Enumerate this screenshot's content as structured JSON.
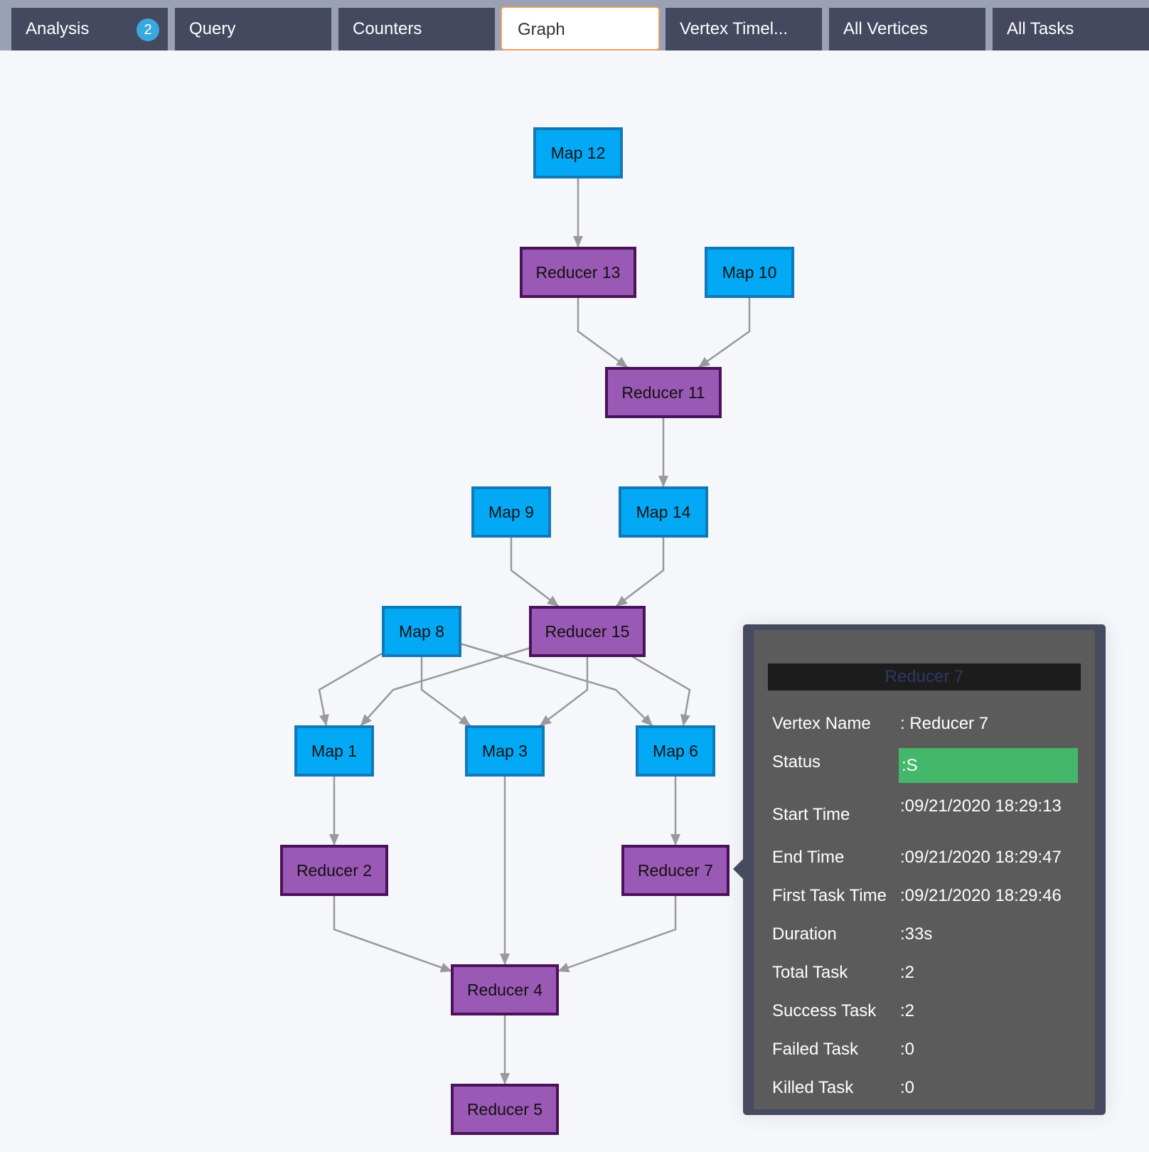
{
  "tabs": [
    {
      "label": "Analysis",
      "badge": "2",
      "active": false
    },
    {
      "label": "Query",
      "active": false
    },
    {
      "label": "Counters",
      "active": false
    },
    {
      "label": "Graph",
      "active": true
    },
    {
      "label": "Vertex Timel...",
      "active": false
    },
    {
      "label": "All Vertices",
      "active": false
    },
    {
      "label": "All Tasks",
      "active": false
    }
  ],
  "colors": {
    "map_fill": "#03a9f4",
    "map_stroke": "#1378b7",
    "reducer_fill": "#9b59b6",
    "reducer_stroke": "#4a1259",
    "status_success": "#44b76b",
    "active_tab_border": "#f0a060"
  },
  "graph": {
    "nodes": [
      {
        "id": "map12",
        "label": "Map 12",
        "type": "map"
      },
      {
        "id": "red13",
        "label": "Reducer 13",
        "type": "reducer"
      },
      {
        "id": "map10",
        "label": "Map 10",
        "type": "map"
      },
      {
        "id": "red11",
        "label": "Reducer 11",
        "type": "reducer"
      },
      {
        "id": "map9",
        "label": "Map 9",
        "type": "map"
      },
      {
        "id": "map14",
        "label": "Map 14",
        "type": "map"
      },
      {
        "id": "map8",
        "label": "Map 8",
        "type": "map"
      },
      {
        "id": "red15",
        "label": "Reducer 15",
        "type": "reducer"
      },
      {
        "id": "map1",
        "label": "Map 1",
        "type": "map"
      },
      {
        "id": "map3",
        "label": "Map 3",
        "type": "map"
      },
      {
        "id": "map6",
        "label": "Map 6",
        "type": "map"
      },
      {
        "id": "red2",
        "label": "Reducer 2",
        "type": "reducer"
      },
      {
        "id": "red7",
        "label": "Reducer 7",
        "type": "reducer"
      },
      {
        "id": "red4",
        "label": "Reducer 4",
        "type": "reducer"
      },
      {
        "id": "red5",
        "label": "Reducer 5",
        "type": "reducer"
      }
    ],
    "edges": [
      {
        "from": "map12",
        "to": "red13"
      },
      {
        "from": "red13",
        "to": "red11"
      },
      {
        "from": "map10",
        "to": "red11"
      },
      {
        "from": "red11",
        "to": "map14"
      },
      {
        "from": "map9",
        "to": "red15"
      },
      {
        "from": "map14",
        "to": "red15"
      },
      {
        "from": "map8",
        "to": "map1"
      },
      {
        "from": "map8",
        "to": "map3"
      },
      {
        "from": "map8",
        "to": "map6"
      },
      {
        "from": "red15",
        "to": "map1"
      },
      {
        "from": "red15",
        "to": "map3"
      },
      {
        "from": "red15",
        "to": "map6"
      },
      {
        "from": "map1",
        "to": "red2"
      },
      {
        "from": "map6",
        "to": "red7"
      },
      {
        "from": "map3",
        "to": "red4"
      },
      {
        "from": "red2",
        "to": "red4"
      },
      {
        "from": "red7",
        "to": "red4"
      },
      {
        "from": "red4",
        "to": "red5"
      }
    ]
  },
  "tooltip": {
    "title": "Reducer 7",
    "rows": [
      {
        "key": "Vertex Name",
        "value": ": Reducer 7"
      },
      {
        "key": "Status",
        "value": ":S"
      },
      {
        "key": "Start Time",
        "value": ":09/21/2020 18:29:13"
      },
      {
        "key": "End Time",
        "value": ":09/21/2020 18:29:47"
      },
      {
        "key": "First Task Time",
        "value": ":09/21/2020 18:29:46"
      },
      {
        "key": "Duration",
        "value": ":33s"
      },
      {
        "key": "Total Task",
        "value": ":2"
      },
      {
        "key": "Success Task",
        "value": ":2"
      },
      {
        "key": "Failed Task",
        "value": ":0"
      },
      {
        "key": "Killed Task",
        "value": ":0"
      }
    ]
  }
}
